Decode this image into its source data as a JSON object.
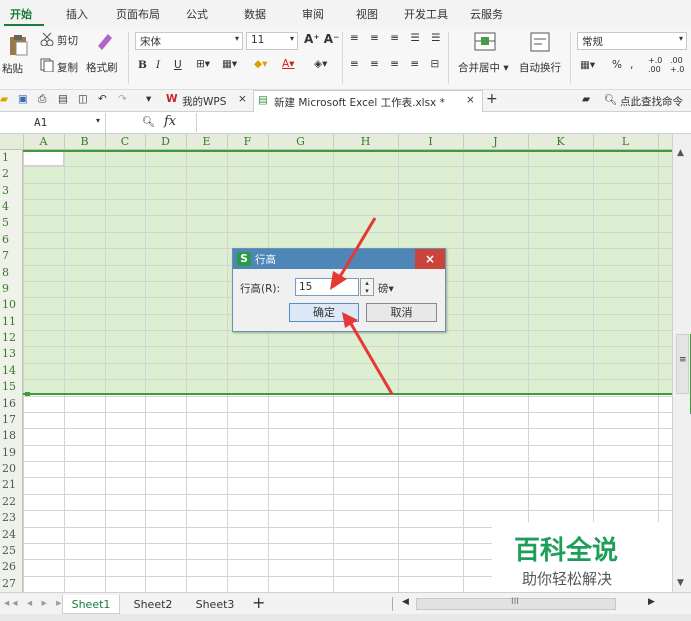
{
  "ribbon_tabs": [
    "开始",
    "插入",
    "页面布局",
    "公式",
    "数据",
    "审阅",
    "视图",
    "开发工具",
    "云服务"
  ],
  "ribbon": {
    "cut": "剪切",
    "copy": "复制",
    "paste": "粘贴",
    "format_painter": "格式刷",
    "font_name": "宋体",
    "font_size": "11",
    "merge_center": "合并居中",
    "wrap_text": "自动换行",
    "number_format": "常规",
    "percent": "%"
  },
  "docbar": {
    "my_wps": "我的WPS",
    "file_tab": "新建 Microsoft Excel 工作表.xlsx *",
    "search": "点此查找命令"
  },
  "formula_bar": {
    "name_box": "A1",
    "fx": "fx"
  },
  "columns": [
    "A",
    "B",
    "C",
    "D",
    "E",
    "F",
    "G",
    "H",
    "I",
    "J",
    "K",
    "L"
  ],
  "rows": [
    "1",
    "2",
    "3",
    "4",
    "5",
    "6",
    "7",
    "8",
    "9",
    "10",
    "11",
    "12",
    "13",
    "14",
    "15",
    "16",
    "17",
    "18",
    "19",
    "20",
    "21",
    "22",
    "23",
    "24",
    "25",
    "26",
    "27"
  ],
  "dialog": {
    "title": "行高",
    "label": "行高(R):",
    "value": "15",
    "unit": "磅▾",
    "ok": "确定",
    "cancel": "取消"
  },
  "sheets": [
    "Sheet1",
    "Sheet2",
    "Sheet3"
  ],
  "active_sheet": "Sheet1",
  "watermark": {
    "title": "百科全说",
    "subtitle": "助你轻松解决"
  },
  "colors": {
    "accent": "#1c7a3c",
    "selection": "#dcefd0",
    "dialog_title": "#4f86b8",
    "close": "#c9443a",
    "arrow": "#e53935"
  }
}
